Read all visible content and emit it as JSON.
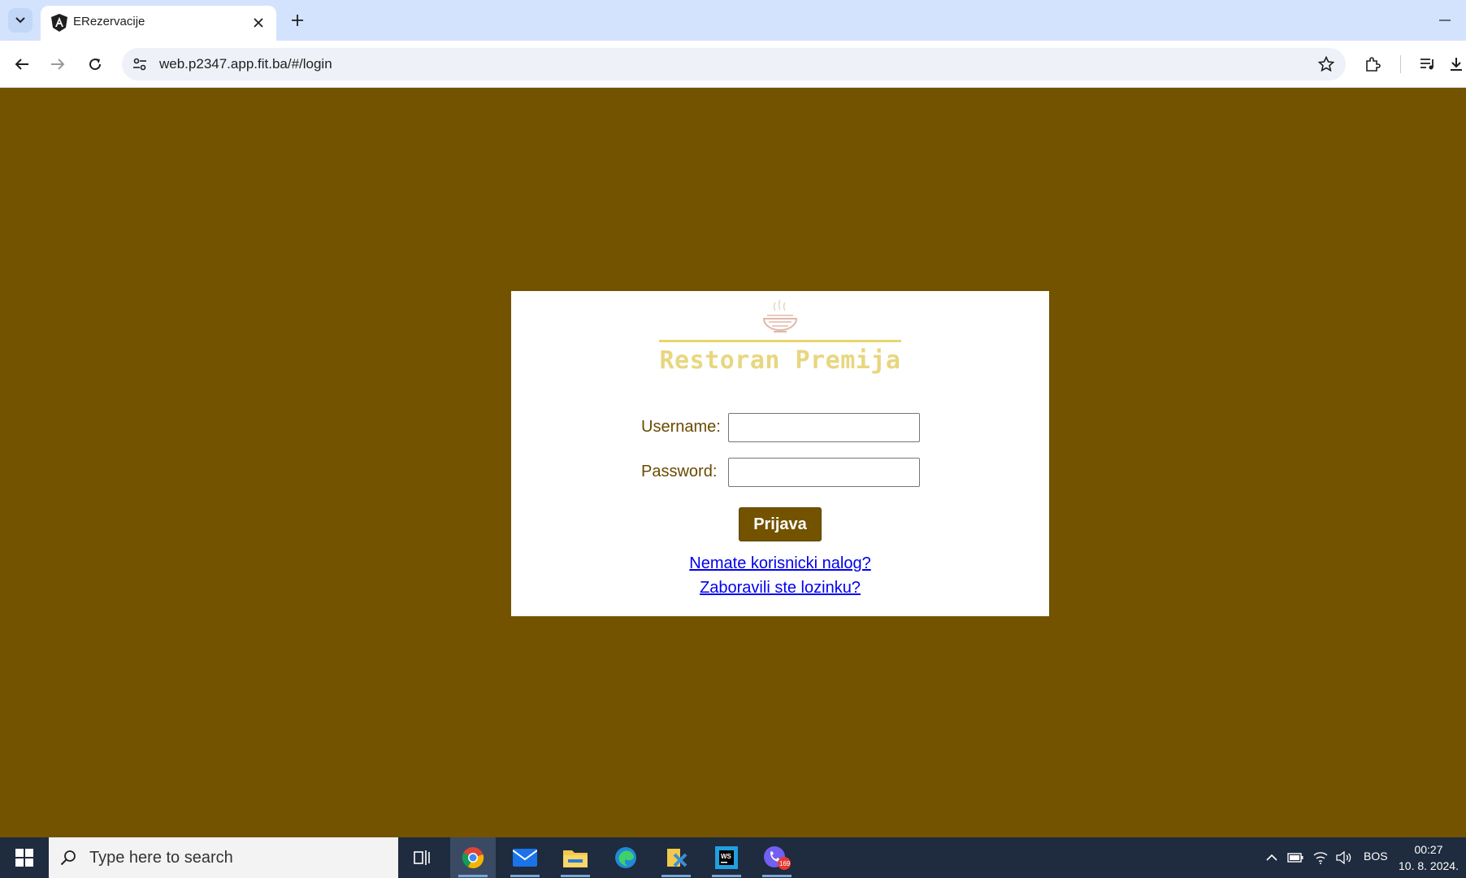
{
  "browser": {
    "tab": {
      "title": "ERezervacije",
      "favicon": "angular-icon"
    },
    "url": "web.p2347.app.fit.ba/#/login"
  },
  "login": {
    "logo_text": "Restoran Premija",
    "username_label": "Username:",
    "password_label": "Password:",
    "username_value": "",
    "password_value": "",
    "submit_label": "Prijava",
    "register_link": "Nemate korisnicki nalog?",
    "forgot_link": "Zaboravili ste lozinku?"
  },
  "taskbar": {
    "search_placeholder": "Type here to search",
    "apps": [
      "task-view",
      "chrome",
      "mail",
      "file-explorer",
      "edge",
      "vm-app",
      "webstorm",
      "viber"
    ],
    "viber_badge": "169",
    "language": "BOS",
    "time": "00:27",
    "date": "10. 8. 2024."
  },
  "colors": {
    "page_bg": "#735300",
    "button_bg": "#735300",
    "logo_text": "#e8d680",
    "link": "#0000ee",
    "tabstrip": "#d3e3fd",
    "taskbar": "#1f2b3e"
  }
}
